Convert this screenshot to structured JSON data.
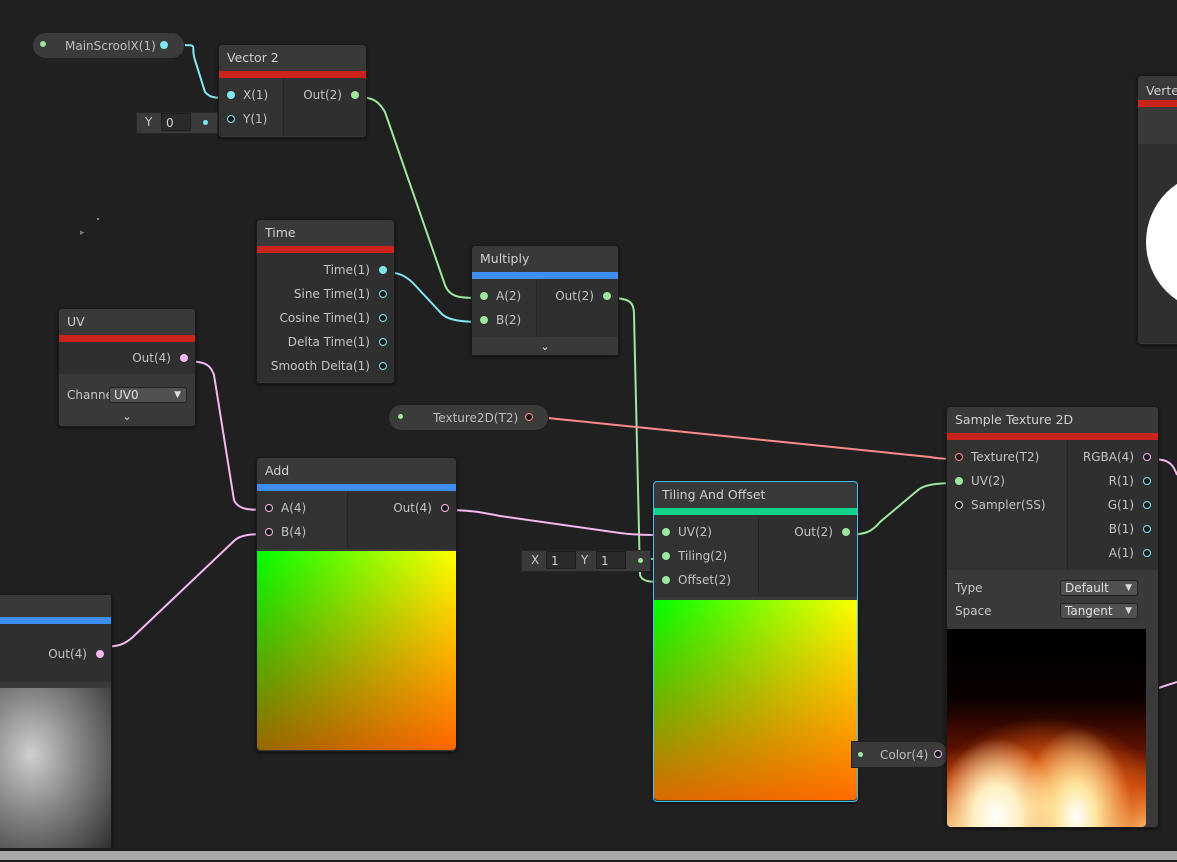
{
  "nodes": {
    "mainscroll": {
      "label": "MainScroolX(1)"
    },
    "vector2": {
      "title": "Vector 2",
      "in_x": "X(1)",
      "in_y": "Y(1)",
      "out": "Out(2)",
      "y_field_label": "Y",
      "y_field_value": "0"
    },
    "time": {
      "title": "Time",
      "outputs": [
        "Time(1)",
        "Sine Time(1)",
        "Cosine Time(1)",
        "Delta Time(1)",
        "Smooth Delta(1)"
      ]
    },
    "multiply": {
      "title": "Multiply",
      "in_a": "A(2)",
      "in_b": "B(2)",
      "out": "Out(2)"
    },
    "uv": {
      "title": "UV",
      "out": "Out(4)",
      "channel_label": "Channe",
      "channel_value": "UV0"
    },
    "texture_prop": {
      "label": "Texture2D(T2)"
    },
    "add": {
      "title": "Add",
      "in_a": "A(4)",
      "in_b": "B(4)",
      "out": "Out(4)"
    },
    "tiling": {
      "title": "Tiling And Offset",
      "in_uv": "UV(2)",
      "in_tiling": "Tiling(2)",
      "in_offset": "Offset(2)",
      "out": "Out(2)",
      "x_label": "X",
      "x_value": "1",
      "y_label": "Y",
      "y_value": "1"
    },
    "sample": {
      "title": "Sample Texture 2D",
      "in_texture": "Texture(T2)",
      "in_uv": "UV(2)",
      "in_sampler": "Sampler(SS)",
      "out_rgba": "RGBA(4)",
      "out_r": "R(1)",
      "out_g": "G(1)",
      "out_b": "B(1)",
      "out_a": "A(1)",
      "type_label": "Type",
      "type_value": "Default",
      "space_label": "Space",
      "space_value": "Tangent"
    },
    "color_prop": {
      "label": "Color(4)"
    },
    "left_node": {
      "out": "Out(4)"
    },
    "vertex": {
      "title": "Verte"
    }
  },
  "colors": {
    "background": "#202020",
    "header_red": "#c9231c",
    "header_blue": "#3d8ef0",
    "header_teal": "#12d48a",
    "wire_green": "#9ee69e",
    "wire_cyan": "#7fe8f0",
    "wire_pink": "#f3b8f0",
    "wire_red": "#ff8a8a",
    "selection": "#44c0ff"
  }
}
